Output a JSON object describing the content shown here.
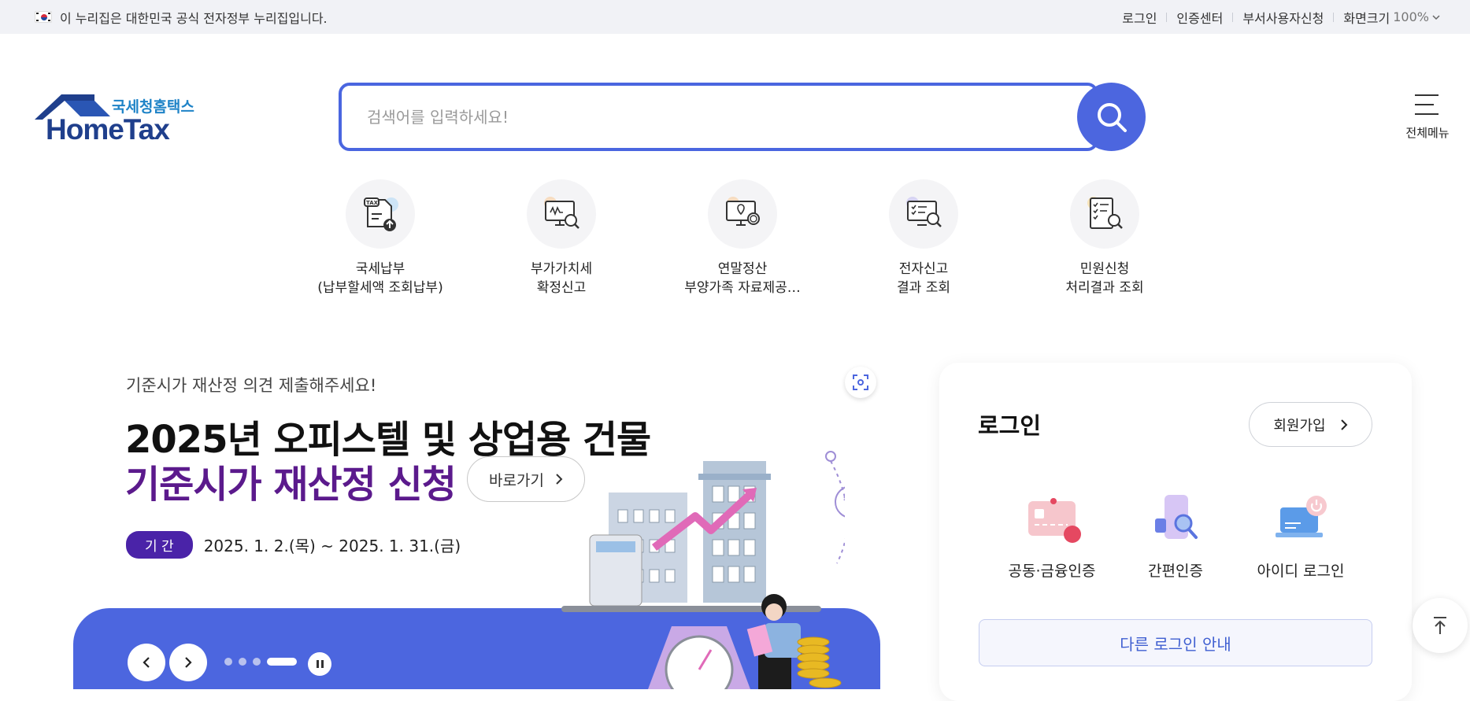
{
  "topbar": {
    "notice": "이 누리집은 대한민국 공식 전자정부 누리집입니다.",
    "links": [
      "로그인",
      "인증센터",
      "부서사용자신청",
      "화면크기"
    ],
    "zoom": "100%"
  },
  "logo": {
    "sub": "국세청홈택스",
    "main": "HomeTax"
  },
  "search": {
    "placeholder": "검색어를 입력하세요!"
  },
  "menu": {
    "label": "전체메뉴"
  },
  "quick": [
    {
      "line1": "국세납부",
      "line2": "(납부할세액 조회납부)",
      "icon": "tax-payment-icon"
    },
    {
      "line1": "부가가치세",
      "line2": "확정신고",
      "icon": "vat-report-icon"
    },
    {
      "line1": "연말정산",
      "line2": "부양가족 자료제공…",
      "icon": "year-end-settlement-icon"
    },
    {
      "line1": "전자신고",
      "line2": "결과 조회",
      "icon": "e-filing-result-icon"
    },
    {
      "line1": "민원신청",
      "line2": "처리결과 조회",
      "icon": "civil-petition-icon"
    }
  ],
  "banner": {
    "kicker": "기준시가 재산정 의견 제출해주세요!",
    "headline1": "2025년 오피스텔 및 상업용 건물",
    "headline2": "기준시가 재산정 신청",
    "go_label": "바로가기",
    "period_tag": "기 간",
    "period": "2025. 1. 2.(목) ~ 2025. 1. 31.(금)",
    "slides": 4,
    "active_slide": 4
  },
  "login": {
    "title": "로그인",
    "join": "회원가입",
    "options": [
      "공동·금융인증",
      "간편인증",
      "아이디 로그인"
    ],
    "other": "다른 로그인 안내"
  },
  "colors": {
    "accent": "#4c66df",
    "purple": "#5b1a8c",
    "navy": "#1f3f8c"
  }
}
